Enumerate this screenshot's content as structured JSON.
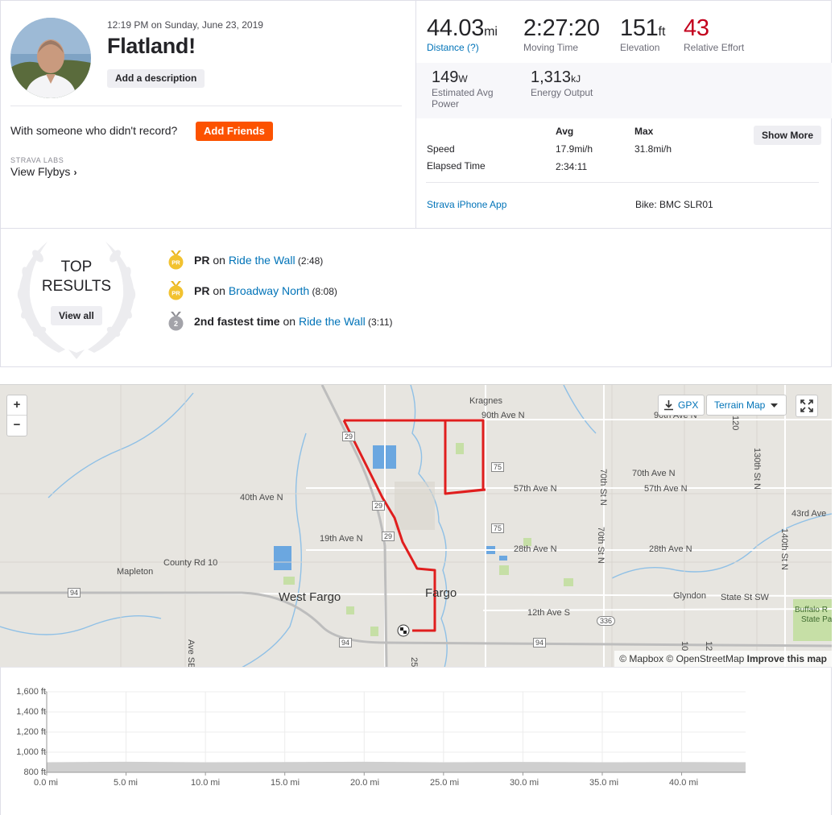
{
  "activity": {
    "datetime": "12:19 PM on Sunday, June 23, 2019",
    "title": "Flatland!",
    "add_description_label": "Add a description",
    "with_someone_text": "With someone who didn't record?",
    "add_friends_label": "Add Friends",
    "labs_label": "STRAVA LABS",
    "flybys_label": "View Flybys"
  },
  "stats": {
    "distance": {
      "value": "44.03",
      "unit": "mi",
      "label": "Distance (?)"
    },
    "moving_time": {
      "value": "2:27:20",
      "label": "Moving Time"
    },
    "elevation": {
      "value": "151",
      "unit": "ft",
      "label": "Elevation"
    },
    "relative_effort": {
      "value": "43",
      "label": "Relative Effort"
    },
    "power": {
      "value": "149",
      "unit": "W",
      "label_line1": "Estimated Avg",
      "label_line2": "Power"
    },
    "energy": {
      "value": "1,313",
      "unit": "kJ",
      "label": "Energy Output"
    },
    "table": {
      "col_avg": "Avg",
      "col_max": "Max",
      "speed_label": "Speed",
      "speed_avg": "17.9mi/h",
      "speed_max": "31.8mi/h",
      "elapsed_label": "Elapsed Time",
      "elapsed_avg": "2:34:11"
    },
    "show_more_label": "Show More",
    "device": "Strava iPhone App",
    "bike": "Bike: BMC SLR01"
  },
  "top_results": {
    "title_line1": "TOP",
    "title_line2": "RESULTS",
    "view_all_label": "View all",
    "items": [
      {
        "medal": "pr-medal-icon",
        "medal_text": "PR",
        "achievement": "PR",
        "on": " on ",
        "segment": "Ride the Wall",
        "time": " (2:48)"
      },
      {
        "medal": "pr-medal-icon",
        "medal_text": "PR",
        "achievement": "PR",
        "on": " on ",
        "segment": "Broadway North",
        "time": " (8:08)"
      },
      {
        "medal": "silver-medal-icon",
        "medal_text": "2",
        "achievement": "2nd fastest time",
        "on": " on ",
        "segment": "Ride the Wall",
        "time": " (3:11)"
      }
    ]
  },
  "map": {
    "zoom_in": "+",
    "zoom_out": "−",
    "gpx_label": "GPX",
    "terrain_label": "Terrain Map",
    "attribution_prefix": "© Mapbox © OpenStreetMap",
    "improve_label": "Improve this map",
    "labels": {
      "kragnes": "Kragnes",
      "ave90": "90th Ave N",
      "ave90b": "90th Ave N",
      "ave70": "70th Ave N",
      "ave57a": "57th Ave N",
      "ave57b": "57th Ave N",
      "ave40": "40th Ave N",
      "ave43": "43rd Ave",
      "ave19": "19th Ave N",
      "ave28a": "28th Ave N",
      "ave28b": "28th Ave N",
      "county10": "County Rd 10",
      "mapleton": "Mapleton",
      "westfargo": "West Fargo",
      "fargo": "Fargo",
      "glyndon": "Glyndon",
      "statest": "State St SW",
      "ave12": "12th Ave S",
      "buffalo1": "Buffalo R",
      "buffalo2": "State Pa",
      "st70a": "70th St N",
      "st70b": "70th St N",
      "st130": "130th St N",
      "st140": "140th St N",
      "avese": "Ave SE",
      "s120": "120",
      "r10": "10",
      "r12": "12",
      "r25": "25",
      "hw29a": "29",
      "hw29b": "29",
      "hw29c": "29",
      "hw75a": "75",
      "hw75b": "75",
      "hw94a": "94",
      "hw94b": "94",
      "hw94c": "94",
      "hw336": "336"
    },
    "route_color": "#e01e1e"
  },
  "elevation_chart": {
    "type": "area",
    "y_ticks": [
      "1,600 ft",
      "1,400 ft",
      "1,200 ft",
      "1,000 ft",
      "800 ft"
    ],
    "x_ticks": [
      "0.0 mi",
      "5.0 mi",
      "10.0 mi",
      "15.0 mi",
      "20.0 mi",
      "25.0 mi",
      "30.0 mi",
      "35.0 mi",
      "40.0 mi"
    ],
    "ylim": [
      800,
      1600
    ],
    "xlim": [
      0,
      44.03
    ],
    "x": [
      0,
      5,
      10,
      15,
      20,
      25,
      30,
      35,
      40,
      44.03
    ],
    "y": [
      900,
      905,
      900,
      902,
      905,
      900,
      903,
      900,
      902,
      900
    ],
    "fill_color": "#cfcfcf"
  }
}
